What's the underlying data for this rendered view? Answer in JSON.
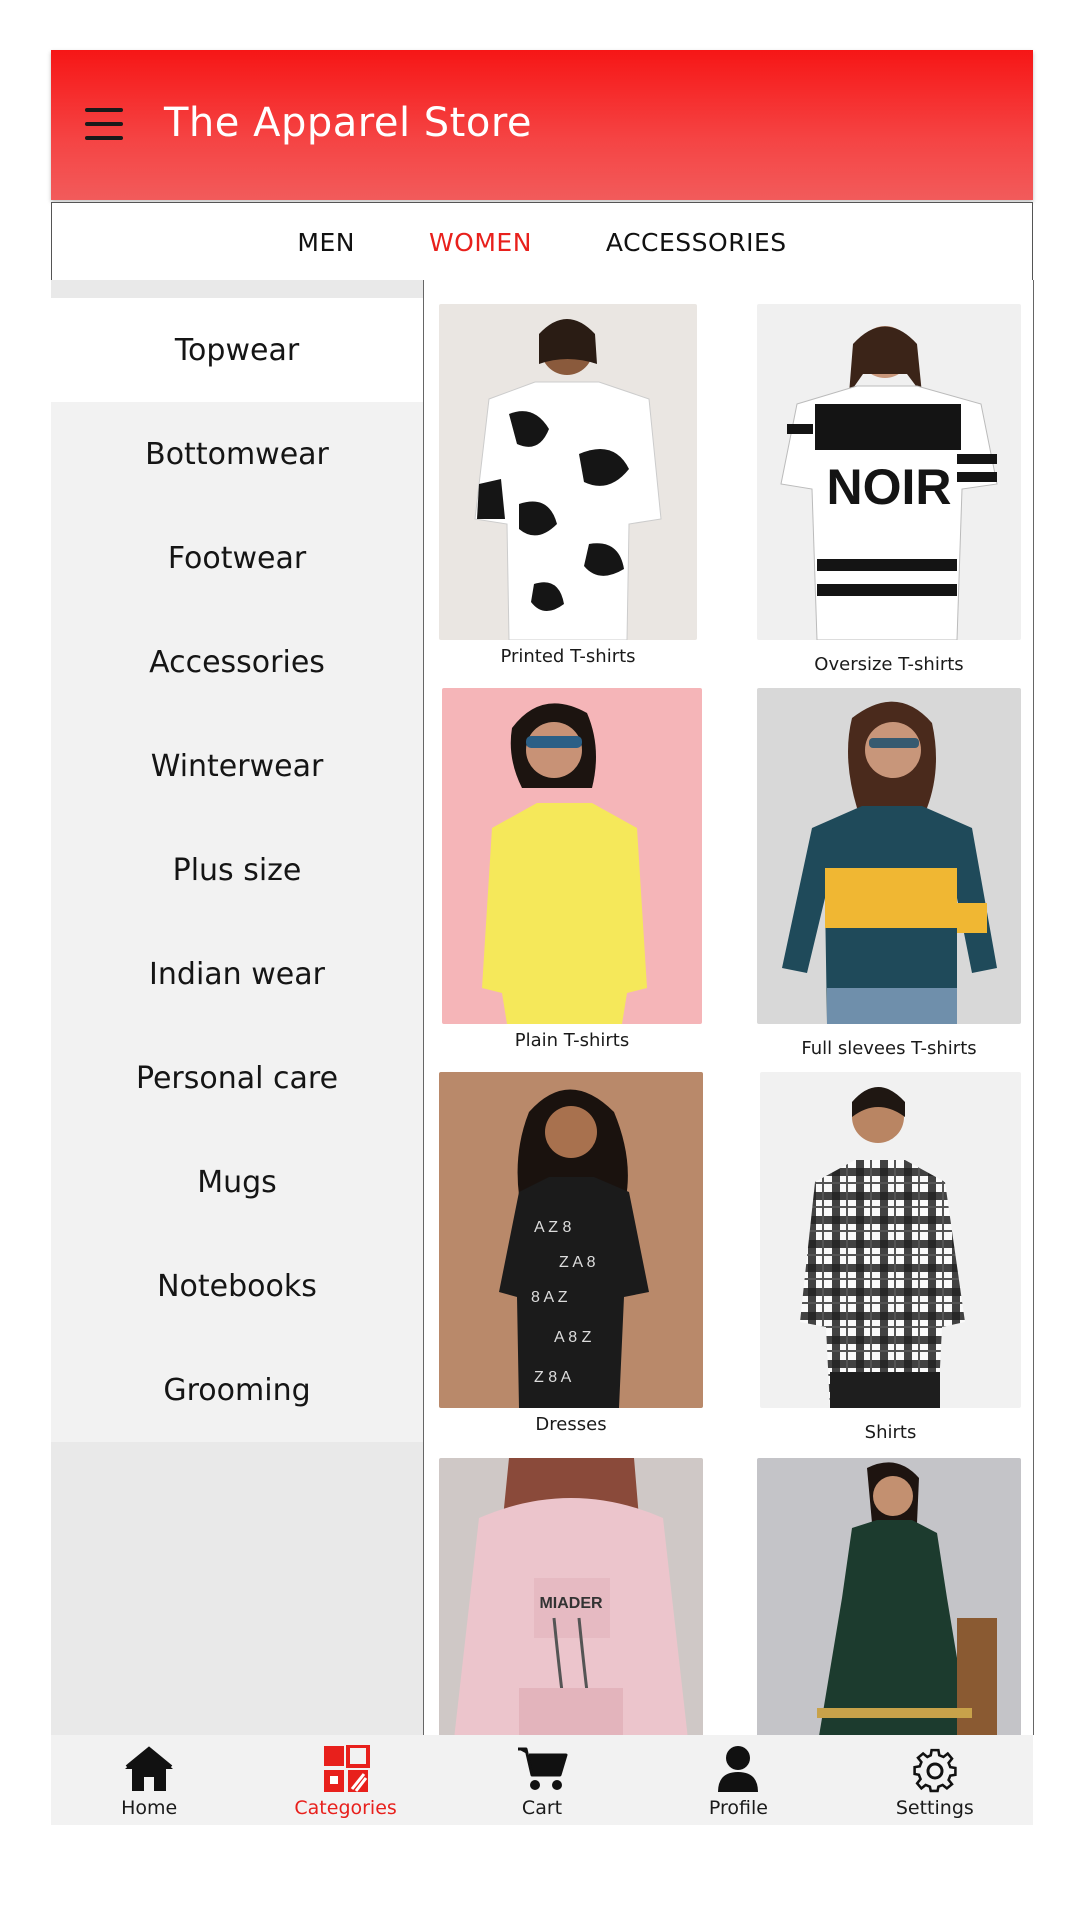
{
  "header": {
    "title": "The Apparel Store"
  },
  "tabs": [
    {
      "label": "MEN",
      "active": false
    },
    {
      "label": "WOMEN",
      "active": true
    },
    {
      "label": "ACCESSORIES",
      "active": false
    }
  ],
  "sidebar": {
    "items": [
      {
        "label": "Topwear",
        "active": true
      },
      {
        "label": "Bottomwear"
      },
      {
        "label": "Footwear"
      },
      {
        "label": "Accessories"
      },
      {
        "label": "Winterwear"
      },
      {
        "label": "Plus size"
      },
      {
        "label": "Indian wear"
      },
      {
        "label": "Personal care"
      },
      {
        "label": "Mugs"
      },
      {
        "label": "Notebooks"
      },
      {
        "label": "Grooming"
      }
    ]
  },
  "products": [
    {
      "caption": "Printed T-shirts"
    },
    {
      "caption": "Oversize T-shirts"
    },
    {
      "caption": "Plain T-shirts"
    },
    {
      "caption": "Full slevees T-shirts"
    },
    {
      "caption": "Dresses"
    },
    {
      "caption": "Shirts"
    },
    {
      "caption": ""
    },
    {
      "caption": ""
    }
  ],
  "bottom_nav": [
    {
      "label": "Home",
      "icon": "home-icon"
    },
    {
      "label": "Categories",
      "icon": "categories-icon",
      "active": true
    },
    {
      "label": "Cart",
      "icon": "cart-icon"
    },
    {
      "label": "Profile",
      "icon": "profile-icon"
    },
    {
      "label": "Settings",
      "icon": "settings-icon"
    }
  ],
  "colors": {
    "accent": "#e8201c",
    "header_top": "#f61616",
    "header_bottom": "#f25b5b"
  }
}
